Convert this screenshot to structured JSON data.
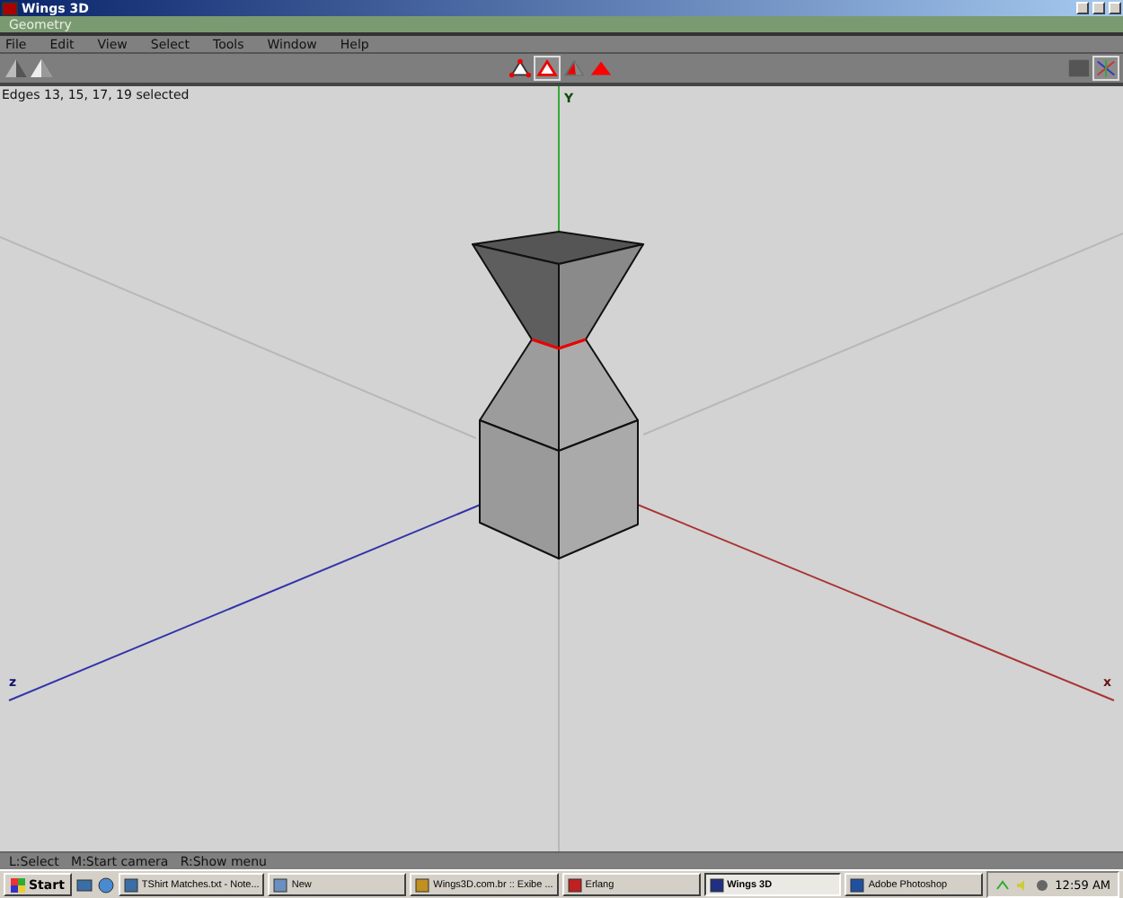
{
  "window": {
    "title": "Wings 3D"
  },
  "geometry_bar": {
    "title": "Geometry"
  },
  "menu": [
    "File",
    "Edit",
    "View",
    "Select",
    "Tools",
    "Window",
    "Help"
  ],
  "select_modes": [
    {
      "kind": "vertex",
      "selected": false
    },
    {
      "kind": "edge",
      "selected": true
    },
    {
      "kind": "face",
      "selected": false
    },
    {
      "kind": "body",
      "selected": false
    }
  ],
  "view_toggles": [
    {
      "kind": "shaded",
      "selected": false
    },
    {
      "kind": "axes",
      "selected": true
    }
  ],
  "viewport": {
    "selection_info": "Edges 13, 15, 17, 19 selected",
    "axis_labels": [
      {
        "kind": "y",
        "text": "Y"
      },
      {
        "kind": "z",
        "text": "z"
      },
      {
        "kind": "x",
        "text": "x"
      }
    ]
  },
  "status_bar": {
    "hint": "L:Select   M:Start camera   R:Show menu"
  },
  "taskbar": {
    "start": "Start",
    "tasks": [
      {
        "label": "TShirt Matches.txt - Note...",
        "selected": false
      },
      {
        "label": "New",
        "selected": false
      },
      {
        "label": "Wings3D.com.br :: Exibe ...",
        "selected": false
      },
      {
        "label": "Erlang",
        "selected": false
      },
      {
        "label": "Wings 3D",
        "selected": true
      },
      {
        "label": "Adobe Photoshop",
        "selected": false
      }
    ],
    "clock": "12:59 AM"
  }
}
